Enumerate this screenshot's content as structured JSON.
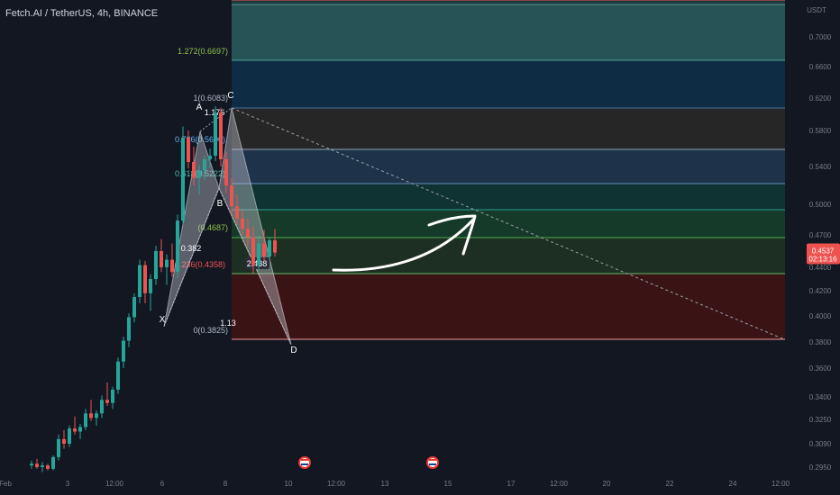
{
  "header": {
    "symbol": "Fetch.AI / TetherUS, 4h, BINANCE"
  },
  "price_axis": {
    "currency": "USDT",
    "ticks": [
      "0.7000",
      "0.6600",
      "0.6200",
      "0.5800",
      "0.5400",
      "0.5000",
      "0.4700",
      "0.4400",
      "0.4200",
      "0.4000",
      "0.3800",
      "0.3600",
      "0.3400",
      "0.3250",
      "0.3090",
      "0.2950"
    ],
    "current_price": "0.4537",
    "countdown": "02:13:16"
  },
  "time_axis": {
    "ticks": [
      "Feb",
      "3",
      "12:00",
      "6",
      "8",
      "10",
      "12:00",
      "13",
      "15",
      "17",
      "12:00",
      "20",
      "22",
      "24",
      "12:00"
    ]
  },
  "fib_levels": [
    {
      "label": "1.272(0.6697)"
    },
    {
      "label": "1(0.6083)"
    },
    {
      "label": "0.786(0.5600)"
    },
    {
      "label": "0.618(0.5222)"
    },
    {
      "label": "(0.4687)"
    },
    {
      "label": "0.236(0.4358)"
    },
    {
      "label": "0(0.3825)"
    }
  ],
  "pattern": {
    "points": [
      "X",
      "A",
      "B",
      "C",
      "D"
    ],
    "ratios": [
      "1.176",
      "0.382",
      "1.13",
      "2.438"
    ]
  },
  "colors": {
    "background": "#131722",
    "up": "#26a69a",
    "down": "#ef5350",
    "price_tag": "#ef5350",
    "pattern_fill": "#d1d4dc"
  },
  "chart_data": {
    "type": "candlestick",
    "x": [
      "Feb",
      "3",
      "12:00",
      "6",
      "8",
      "10",
      "12:00",
      "13",
      "15",
      "17",
      "12:00",
      "20",
      "22",
      "24",
      "12:00"
    ],
    "y_ticks": [
      0.7,
      0.66,
      0.62,
      0.58,
      0.54,
      0.5,
      0.47,
      0.44,
      0.42,
      0.4,
      0.38,
      0.36,
      0.34,
      0.325,
      0.309,
      0.295
    ],
    "current_price": 0.4537,
    "fibonacci": [
      {
        "ratio": 1.272,
        "price": 0.6697
      },
      {
        "ratio": 1,
        "price": 0.6083
      },
      {
        "ratio": 0.786,
        "price": 0.56
      },
      {
        "ratio": 0.618,
        "price": 0.5222
      },
      {
        "ratio": 0.382,
        "price": 0.4687
      },
      {
        "ratio": 0.236,
        "price": 0.4358
      },
      {
        "ratio": 0,
        "price": 0.3825
      }
    ],
    "harmonic": {
      "X": 0.392,
      "A": 0.579,
      "B": 0.517,
      "C": 0.608,
      "D": 0.378,
      "ratios": {
        "AB": 0.382,
        "BC": 1.13,
        "CD": 2.438,
        "XA": 1.176
      }
    },
    "candles": [
      [
        0.296,
        0.299,
        0.294,
        0.297
      ],
      [
        0.297,
        0.3,
        0.294,
        0.295
      ],
      [
        0.295,
        0.298,
        0.292,
        0.296
      ],
      [
        0.296,
        0.297,
        0.293,
        0.294
      ],
      [
        0.294,
        0.302,
        0.293,
        0.301
      ],
      [
        0.301,
        0.315,
        0.299,
        0.312
      ],
      [
        0.312,
        0.318,
        0.306,
        0.309
      ],
      [
        0.309,
        0.321,
        0.307,
        0.319
      ],
      [
        0.319,
        0.327,
        0.315,
        0.317
      ],
      [
        0.317,
        0.322,
        0.312,
        0.32
      ],
      [
        0.32,
        0.332,
        0.318,
        0.329
      ],
      [
        0.329,
        0.338,
        0.324,
        0.326
      ],
      [
        0.326,
        0.331,
        0.321,
        0.329
      ],
      [
        0.329,
        0.341,
        0.326,
        0.338
      ],
      [
        0.338,
        0.35,
        0.334,
        0.336
      ],
      [
        0.336,
        0.347,
        0.332,
        0.345
      ],
      [
        0.345,
        0.368,
        0.342,
        0.365
      ],
      [
        0.365,
        0.384,
        0.36,
        0.381
      ],
      [
        0.381,
        0.402,
        0.376,
        0.399
      ],
      [
        0.399,
        0.418,
        0.395,
        0.415
      ],
      [
        0.415,
        0.447,
        0.41,
        0.442
      ],
      [
        0.442,
        0.446,
        0.41,
        0.418
      ],
      [
        0.418,
        0.434,
        0.404,
        0.43
      ],
      [
        0.43,
        0.46,
        0.425,
        0.455
      ],
      [
        0.455,
        0.466,
        0.436,
        0.44
      ],
      [
        0.44,
        0.452,
        0.425,
        0.447
      ],
      [
        0.447,
        0.462,
        0.432,
        0.436
      ],
      [
        0.436,
        0.49,
        0.431,
        0.484
      ],
      [
        0.484,
        0.585,
        0.48,
        0.572
      ],
      [
        0.572,
        0.58,
        0.538,
        0.545
      ],
      [
        0.545,
        0.562,
        0.52,
        0.528
      ],
      [
        0.528,
        0.541,
        0.51,
        0.536
      ],
      [
        0.536,
        0.552,
        0.526,
        0.548
      ],
      [
        0.548,
        0.56,
        0.538,
        0.552
      ],
      [
        0.552,
        0.61,
        0.546,
        0.602
      ],
      [
        0.602,
        0.608,
        0.54,
        0.548
      ],
      [
        0.548,
        0.556,
        0.512,
        0.52
      ],
      [
        0.52,
        0.528,
        0.49,
        0.498
      ],
      [
        0.498,
        0.51,
        0.48,
        0.486
      ],
      [
        0.486,
        0.494,
        0.47,
        0.476
      ],
      [
        0.476,
        0.486,
        0.46,
        0.468
      ],
      [
        0.468,
        0.478,
        0.435,
        0.442
      ],
      [
        0.442,
        0.47,
        0.438,
        0.462
      ],
      [
        0.462,
        0.475,
        0.445,
        0.45
      ],
      [
        0.45,
        0.468,
        0.447,
        0.465
      ],
      [
        0.465,
        0.476,
        0.45,
        0.4537
      ]
    ]
  }
}
